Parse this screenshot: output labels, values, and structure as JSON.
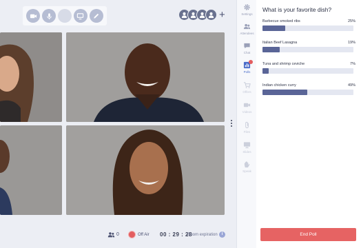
{
  "controls": [
    {
      "icon": "camera-icon"
    },
    {
      "icon": "microphone-icon"
    },
    {
      "icon": "blank-control-icon"
    },
    {
      "icon": "screen-share-icon"
    },
    {
      "icon": "pencil-icon"
    }
  ],
  "participants_add": "+",
  "sidebar": {
    "items": [
      {
        "label": "Settings",
        "icon": "gear-icon"
      },
      {
        "label": "Attendees",
        "icon": "attendees-icon"
      },
      {
        "label": "Chat",
        "icon": "chat-icon"
      },
      {
        "label": "Polls",
        "icon": "polls-icon",
        "active": true
      },
      {
        "label": "Offers",
        "icon": "cart-icon"
      },
      {
        "label": "Videos",
        "icon": "video-icon"
      },
      {
        "label": "Files",
        "icon": "paperclip-icon"
      },
      {
        "label": "Slides",
        "icon": "slides-icon"
      },
      {
        "label": "Speak",
        "icon": "hand-icon"
      }
    ]
  },
  "poll": {
    "question": "What is your favorite dish?",
    "options": [
      {
        "label": "Barbecue smoked ribs",
        "percent_label": "25%",
        "percent": 25
      },
      {
        "label": "Italian Beef Lasagna",
        "percent_label": "19%",
        "percent": 19
      },
      {
        "label": "Tuna and shrimp ceviche",
        "percent_label": "7%",
        "percent": 7
      },
      {
        "label": "Indian chicken curry",
        "percent_label": "49%",
        "percent": 49
      }
    ],
    "end_button": "End Poll"
  },
  "footer": {
    "attendee_count": "0",
    "off_air": "Off Air",
    "timer": "00 : 29 : 28",
    "room_expiration": "Room expiration",
    "info": "i"
  },
  "colors": {
    "accent": "#5a6597",
    "end_button": "#e66363",
    "record": "#e35d5f",
    "active_nav": "#4a6cc9"
  }
}
